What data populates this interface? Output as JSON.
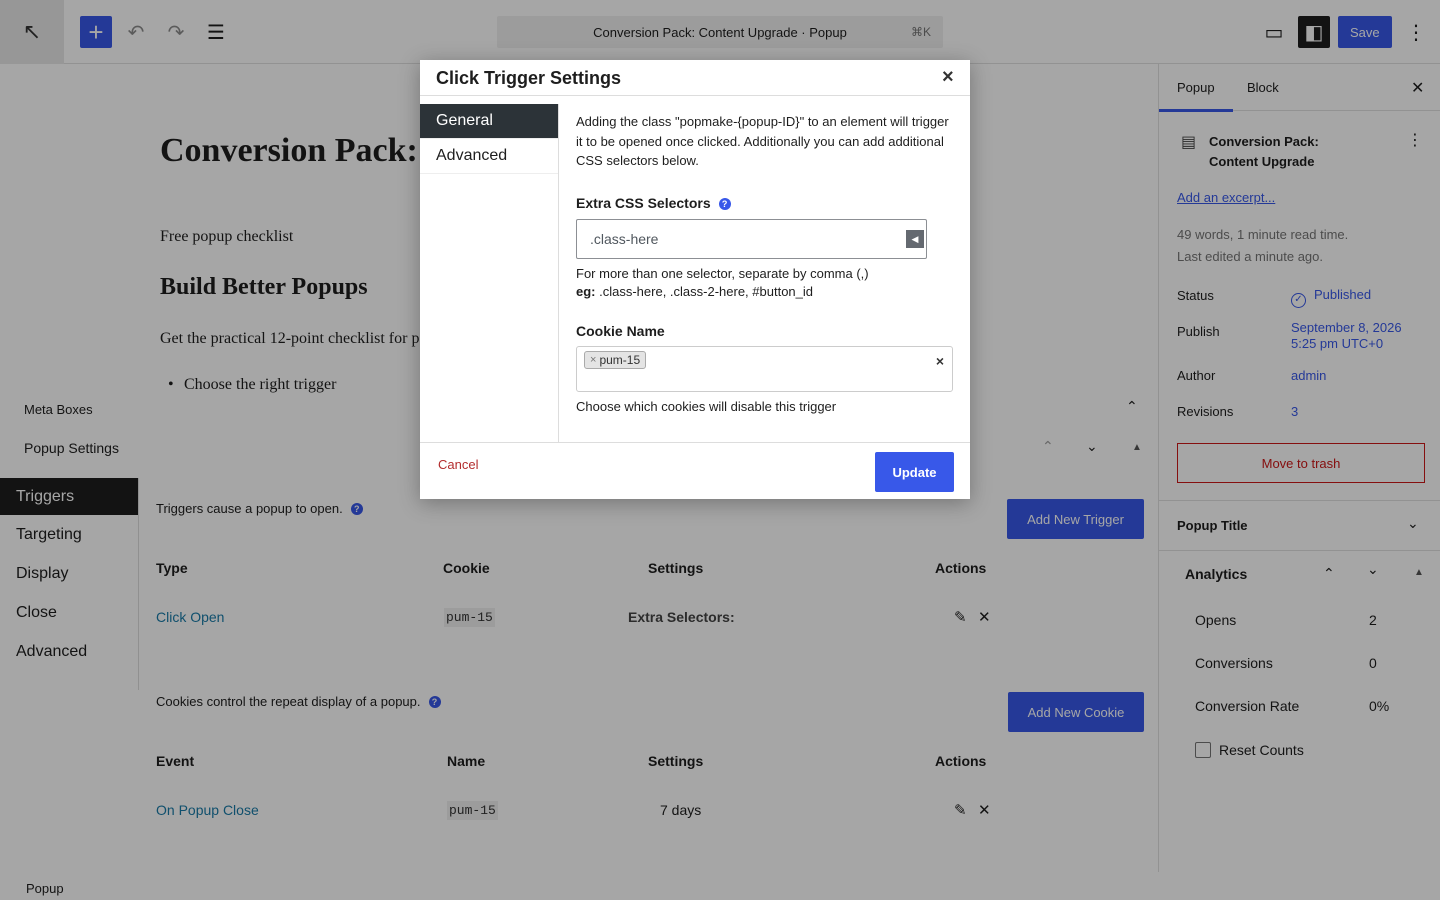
{
  "toolbar": {
    "doc_title": "Conversion Pack: Content Upgrade · Popup",
    "shortcut": "⌘K",
    "save_label": "Save",
    "accent_color": "#3858e9"
  },
  "canvas": {
    "post_title": "Conversion Pack: C",
    "paragraph_1": "Free popup checklist",
    "heading_2": "Build Better Popups",
    "paragraph_2": "Get the practical 12-point checklist for p",
    "list_item_1": "Choose the right trigger"
  },
  "meta_boxes": {
    "title": "Meta Boxes",
    "popup_settings_title": "Popup Settings",
    "tabs": [
      "Triggers",
      "Targeting",
      "Display",
      "Close",
      "Advanced"
    ]
  },
  "triggers": {
    "description": "Triggers cause a popup to open.",
    "add_button": "Add New Trigger",
    "headers": [
      "Type",
      "Cookie",
      "Settings",
      "Actions"
    ],
    "row": {
      "type": "Click Open",
      "cookie": "pum-15",
      "settings": "Extra Selectors:"
    }
  },
  "cookies": {
    "description": "Cookies control the repeat display of a popup.",
    "add_button": "Add New Cookie",
    "headers": [
      "Event",
      "Name",
      "Settings",
      "Actions"
    ],
    "row": {
      "event": "On Popup Close",
      "name": "pum-15",
      "settings": "7 days"
    }
  },
  "footer": {
    "breadcrumb": "Popup"
  },
  "sidebar": {
    "tabs": [
      "Popup",
      "Block"
    ],
    "doc_title": "Conversion Pack: Content Upgrade",
    "excerpt_link": "Add an excerpt...",
    "meta_line_1": "49 words, 1 minute read time.",
    "meta_line_2": "Last edited a minute ago.",
    "status_label": "Status",
    "status_value": "Published",
    "publish_label": "Publish",
    "publish_value_1": "September 8, 2026",
    "publish_value_2": "5:25 pm UTC+0",
    "author_label": "Author",
    "author_value": "admin",
    "revisions_label": "Revisions",
    "revisions_value": "3",
    "trash_label": "Move to trash",
    "popup_title_label": "Popup Title",
    "analytics": {
      "title": "Analytics",
      "opens_label": "Opens",
      "opens_value": "2",
      "conversions_label": "Conversions",
      "conversions_value": "0",
      "rate_label": "Conversion Rate",
      "rate_value": "0%",
      "reset_label": "Reset Counts"
    }
  },
  "modal": {
    "title": "Click Trigger Settings",
    "tabs": [
      "General",
      "Advanced"
    ],
    "intro": "Adding the class \"popmake-{popup-ID}\" to an element will trigger it to be opened once clicked. Additionally you can add additional CSS selectors below.",
    "extra_css_label": "Extra CSS Selectors",
    "extra_css_value": ".class-here",
    "help_line_1": "For more than one selector, separate by comma (,)",
    "help_eg_label": "eg:",
    "help_eg_value": " .class-here, .class-2-here, #button_id",
    "cookie_label": "Cookie Name",
    "cookie_chip": "pum-15",
    "cookie_help": "Choose which cookies will disable this trigger",
    "cancel_label": "Cancel",
    "update_label": "Update"
  }
}
